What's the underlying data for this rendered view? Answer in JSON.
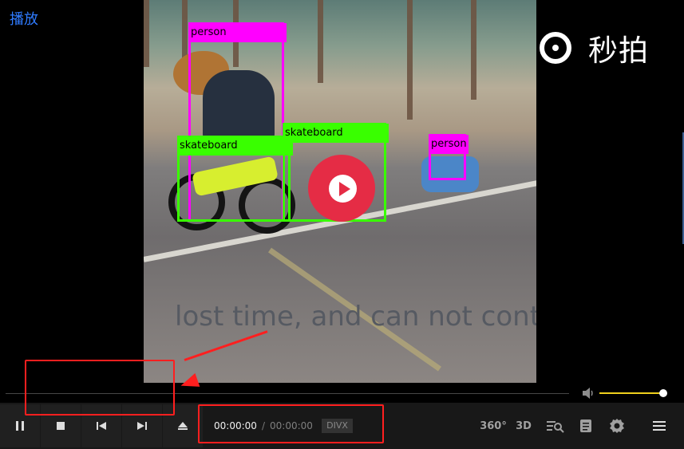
{
  "window": {
    "title": "播放"
  },
  "video": {
    "detections": [
      {
        "label": "person",
        "color": "#ff00ff"
      },
      {
        "label": "skateboard",
        "color": "#39ff00"
      },
      {
        "label": "skateboard",
        "color": "#39ff00"
      },
      {
        "label": "person",
        "color": "#ff00ff"
      }
    ],
    "subtitle": "lost time, and can not control",
    "watermark": "秒拍"
  },
  "player": {
    "controls": {
      "pause_icon": "pause-icon",
      "stop_icon": "stop-icon",
      "previous_icon": "skip-back-icon",
      "next_icon": "skip-forward-icon",
      "eject_icon": "eject-icon"
    },
    "time_current": "00:00:00",
    "time_separator": "/",
    "time_total": "00:00:00",
    "codec": "DIVX",
    "volume_level": 1,
    "tools": {
      "vr": "360°",
      "three_d": "3D",
      "playlist": "playlist-search-icon",
      "info": "info-panel-icon",
      "settings": "gear-icon",
      "menu": "menu-icon"
    }
  },
  "annotations": {
    "highlight_color": "#ff1f1f"
  }
}
